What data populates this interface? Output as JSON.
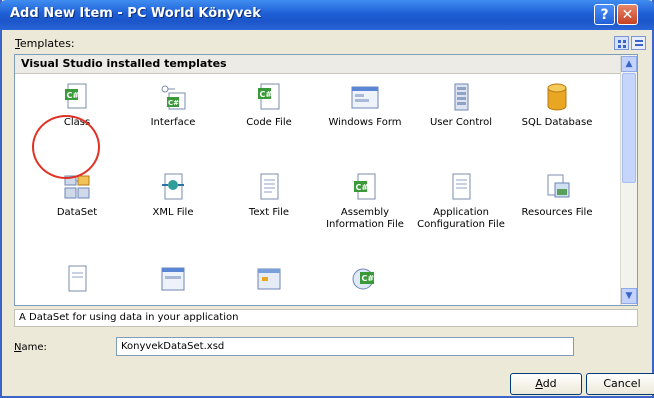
{
  "window": {
    "title": "Add New Item - PC World Könyvek",
    "help_glyph": "?",
    "close_glyph": "✕"
  },
  "templates": {
    "label_accel": "T",
    "label_rest": "emplates:",
    "group_header": "Visual Studio installed templates",
    "items": [
      {
        "label": "Class",
        "icon": "cs-class-icon"
      },
      {
        "label": "Interface",
        "icon": "cs-interface-icon"
      },
      {
        "label": "Code File",
        "icon": "cs-code-file-icon"
      },
      {
        "label": "Windows Form",
        "icon": "windows-form-icon"
      },
      {
        "label": "User Control",
        "icon": "user-control-icon"
      },
      {
        "label": "SQL Database",
        "icon": "sql-database-icon"
      },
      {
        "label": "DataSet",
        "icon": "dataset-icon",
        "selected": true
      },
      {
        "label": "XML File",
        "icon": "xml-file-icon"
      },
      {
        "label": "Text File",
        "icon": "text-file-icon"
      },
      {
        "label": "Assembly Information File",
        "icon": "assembly-info-icon"
      },
      {
        "label": "Application Configuration File",
        "icon": "app-config-icon"
      },
      {
        "label": "Resources File",
        "icon": "resources-file-icon"
      },
      {
        "label": "",
        "icon": "document-icon"
      },
      {
        "label": "",
        "icon": "form-icon"
      },
      {
        "label": "",
        "icon": "dialog-icon"
      },
      {
        "label": "",
        "icon": "cs-wizard-icon"
      }
    ]
  },
  "description": "A DataSet for using data in your application",
  "name_field": {
    "label_accel": "N",
    "label_rest": "ame:",
    "value": "KonyvekDataSet.xsd"
  },
  "buttons": {
    "add_accel": "A",
    "add_rest": "dd",
    "cancel": "Cancel"
  },
  "colors": {
    "title_bar": "#1f5fd6",
    "highlight_circle": "#e03224",
    "dialog_bg": "#ece9d8"
  }
}
